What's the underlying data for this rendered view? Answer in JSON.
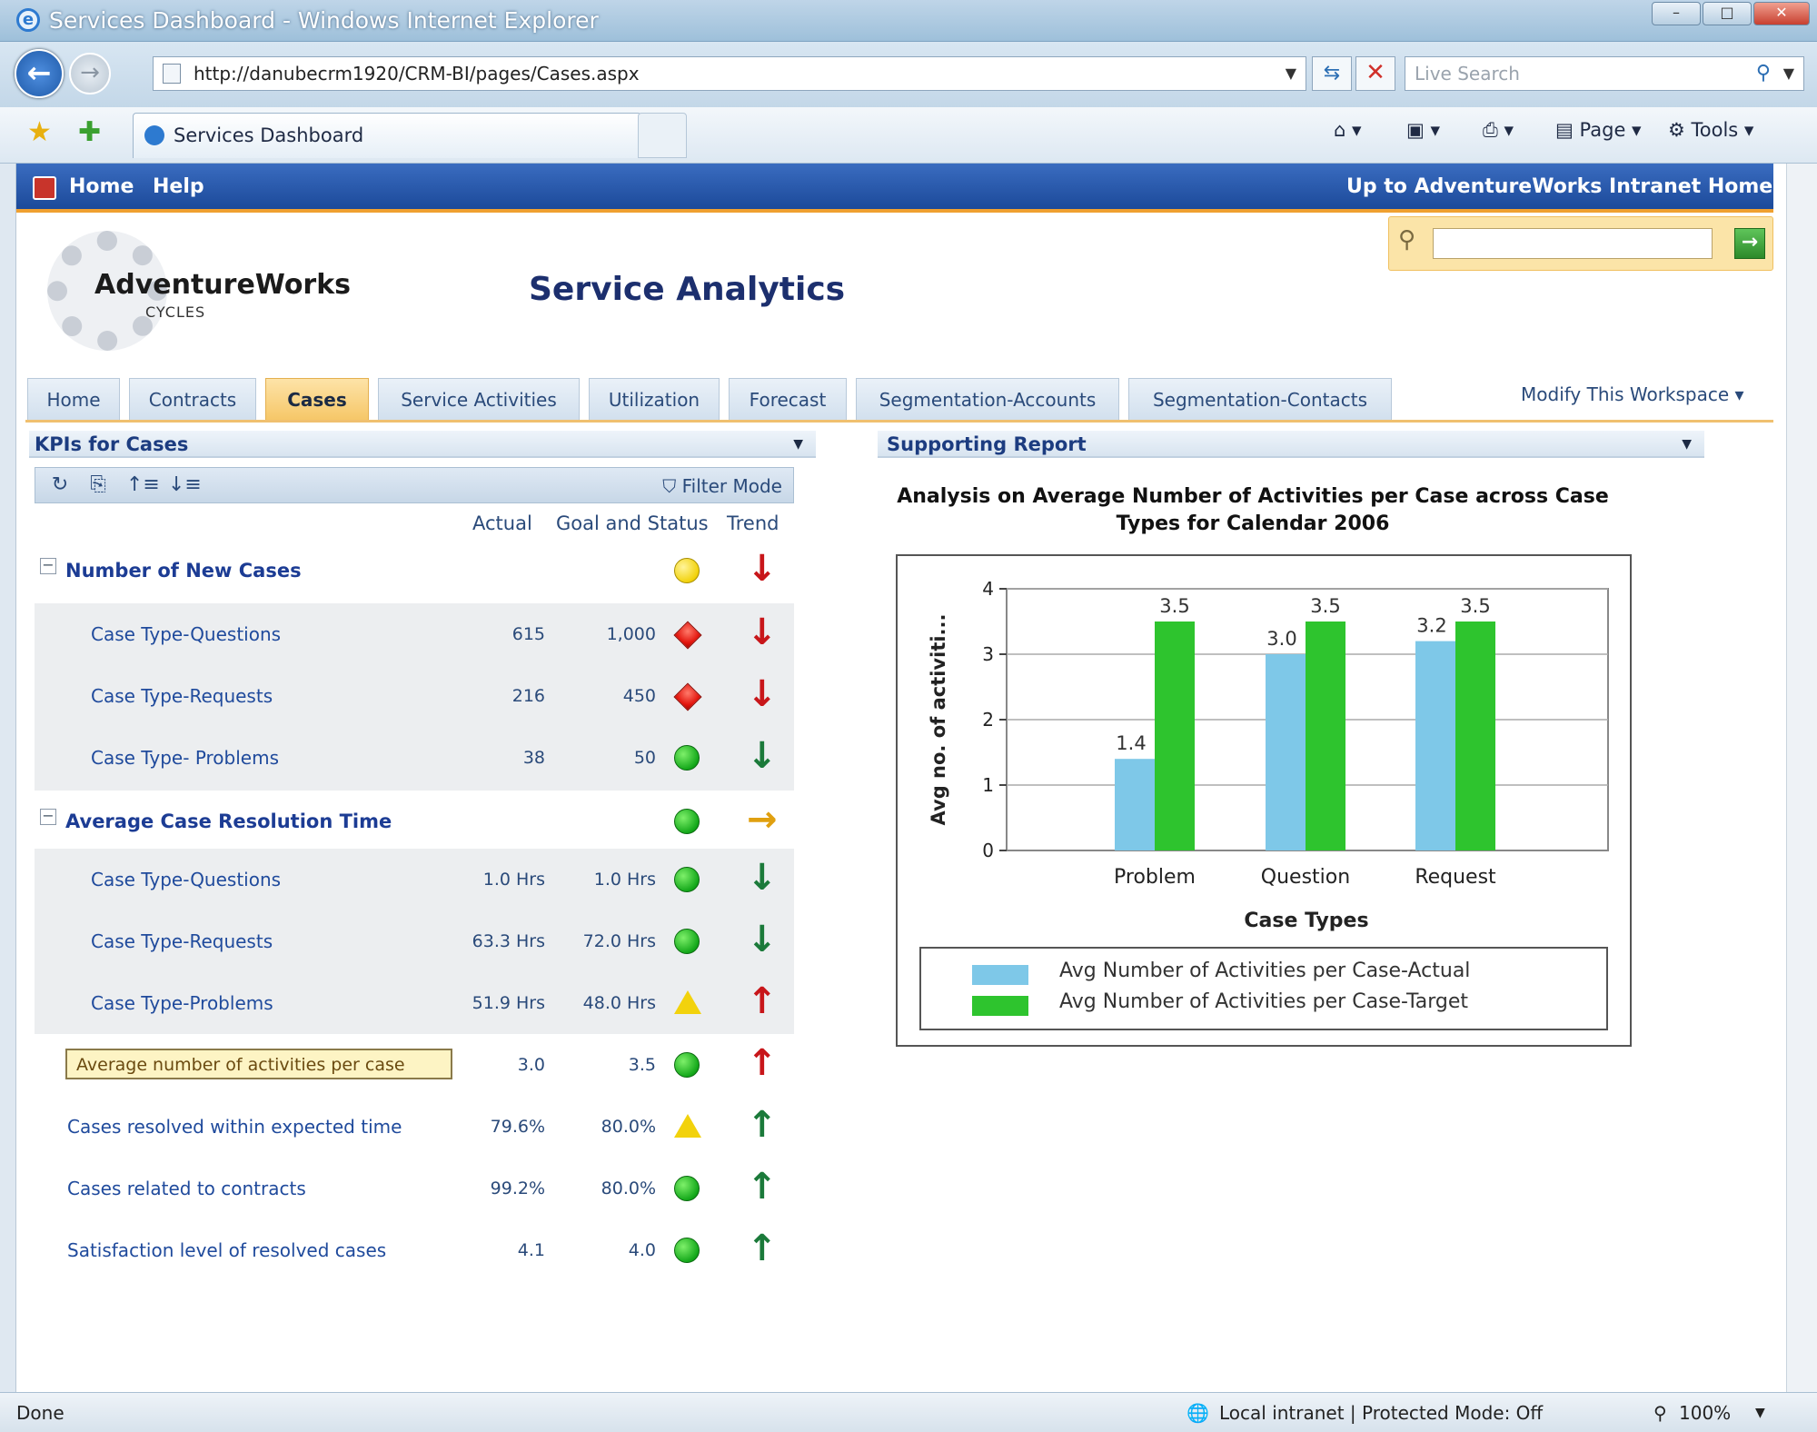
{
  "browser": {
    "window_title": "Services Dashboard - Windows Internet Explorer",
    "address": "http://danubecrm1920/CRM-BI/pages/Cases.aspx",
    "live_search_placeholder": "Live Search",
    "tab_title": "Services Dashboard",
    "cmd_page": "Page",
    "cmd_tools": "Tools",
    "status_left": "Done",
    "status_zone": "Local intranet | Protected Mode: Off",
    "zoom": "100%"
  },
  "site": {
    "nav_home": "Home",
    "nav_help": "Help",
    "nav_up": "Up to AdventureWorks Intranet Home",
    "logo_name": "AdventureWorks",
    "logo_sub": "CYCLES",
    "page_title": "Service Analytics",
    "tabs": [
      "Home",
      "Contracts",
      "Cases",
      "Service Activities",
      "Utilization",
      "Forecast",
      "Segmentation-Accounts",
      "Segmentation-Contacts"
    ],
    "selected_tab": "Cases",
    "modify_workspace": "Modify This Workspace"
  },
  "kpi": {
    "title": "KPIs for Cases",
    "filter_mode": "Filter Mode",
    "col_actual": "Actual",
    "col_goal": "Goal and Status",
    "col_trend": "Trend",
    "rows": [
      {
        "label": "Number of New Cases",
        "actual": "",
        "goal": "",
        "status": "yellow-circle",
        "trend": "down-red",
        "group": true
      },
      {
        "label": "Case Type-Questions",
        "actual": "615",
        "goal": "1,000",
        "status": "red-diamond",
        "trend": "down-red"
      },
      {
        "label": "Case Type-Requests",
        "actual": "216",
        "goal": "450",
        "status": "red-diamond",
        "trend": "down-red"
      },
      {
        "label": "Case Type- Problems",
        "actual": "38",
        "goal": "50",
        "status": "green-circle",
        "trend": "down-green"
      },
      {
        "label": "Average Case Resolution Time",
        "actual": "",
        "goal": "",
        "status": "green-circle",
        "trend": "right-yellow",
        "group": true
      },
      {
        "label": "Case Type-Questions",
        "actual": "1.0 Hrs",
        "goal": "1.0 Hrs",
        "status": "green-circle",
        "trend": "down-green"
      },
      {
        "label": "Case Type-Requests",
        "actual": "63.3 Hrs",
        "goal": "72.0 Hrs",
        "status": "green-circle",
        "trend": "down-green"
      },
      {
        "label": "Case Type-Problems",
        "actual": "51.9 Hrs",
        "goal": "48.0 Hrs",
        "status": "yellow-triangle",
        "trend": "up-red"
      },
      {
        "label": "Average number of activities per case",
        "actual": "3.0",
        "goal": "3.5",
        "status": "green-circle",
        "trend": "up-red",
        "highlight": true
      },
      {
        "label": "Cases resolved within expected time",
        "actual": "79.6%",
        "goal": "80.0%",
        "status": "yellow-triangle",
        "trend": "up-green"
      },
      {
        "label": "Cases related to contracts",
        "actual": "99.2%",
        "goal": "80.0%",
        "status": "green-circle",
        "trend": "up-green"
      },
      {
        "label": "Satisfaction level of resolved cases",
        "actual": "4.1",
        "goal": "4.0",
        "status": "green-circle",
        "trend": "up-green"
      }
    ]
  },
  "report": {
    "header": "Supporting Report"
  },
  "chart_data": {
    "type": "bar",
    "title": "Analysis on Average Number of Activities per Case across Case Types for Calendar 2006",
    "xlabel": "Case Types",
    "ylabel": "Avg no. of activiti...",
    "categories": [
      "Problem",
      "Question",
      "Request"
    ],
    "ylim": [
      0,
      4
    ],
    "yticks": [
      "0",
      "1",
      "2",
      "3",
      "4"
    ],
    "series": [
      {
        "name": "Avg Number of Activities per Case-Actual",
        "values": [
          1.4,
          3.0,
          3.2
        ],
        "labels": [
          "1.4",
          "3.0",
          "3.2"
        ],
        "color": "#7ec8e8"
      },
      {
        "name": "Avg Number of Activities per Case-Target",
        "values": [
          3.5,
          3.5,
          3.5
        ],
        "labels": [
          "3.5",
          "3.5",
          "3.5"
        ],
        "color": "#2ec42e"
      }
    ],
    "grid": true,
    "legend": "bottom"
  }
}
